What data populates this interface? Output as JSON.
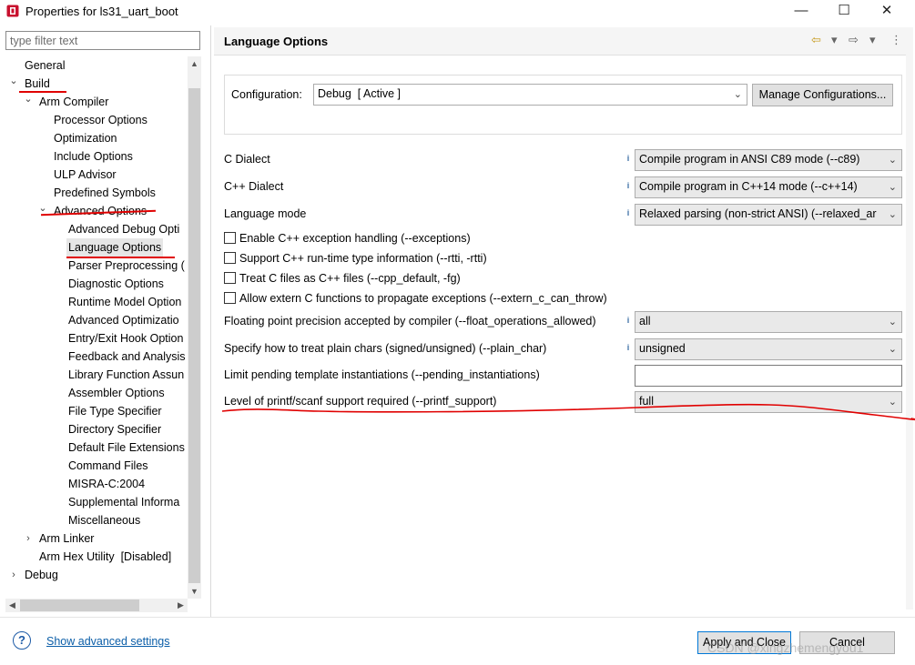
{
  "window": {
    "title": "Properties for ls31_uart_boot",
    "minimize": "—",
    "maximize": "☐",
    "close": "✕"
  },
  "filter": {
    "placeholder": "type filter text"
  },
  "tree": {
    "toggles": {
      "expanded": "⌄",
      "collapsed": "›"
    },
    "items": [
      {
        "label": "General"
      },
      {
        "label": "Build"
      },
      {
        "label": "Arm Compiler"
      },
      {
        "label": "Processor Options"
      },
      {
        "label": "Optimization"
      },
      {
        "label": "Include Options"
      },
      {
        "label": "ULP Advisor"
      },
      {
        "label": "Predefined Symbols"
      },
      {
        "label": "Advanced Options"
      },
      {
        "label": "Advanced Debug Opti"
      },
      {
        "label": "Language Options"
      },
      {
        "label": "Parser Preprocessing ("
      },
      {
        "label": "Diagnostic Options"
      },
      {
        "label": "Runtime Model Option"
      },
      {
        "label": "Advanced Optimizatio"
      },
      {
        "label": "Entry/Exit Hook Option"
      },
      {
        "label": "Feedback and Analysis"
      },
      {
        "label": "Library Function Assun"
      },
      {
        "label": "Assembler Options"
      },
      {
        "label": "File Type Specifier"
      },
      {
        "label": "Directory Specifier"
      },
      {
        "label": "Default File Extensions"
      },
      {
        "label": "Command Files"
      },
      {
        "label": "MISRA-C:2004"
      },
      {
        "label": "Supplemental Informa"
      },
      {
        "label": "Miscellaneous"
      },
      {
        "label": "Arm Linker"
      },
      {
        "label": "Arm Hex Utility  [Disabled]"
      },
      {
        "label": "Debug"
      }
    ]
  },
  "page": {
    "title": "Language Options",
    "nav_back": "⇦",
    "nav_forward": "⇨",
    "nav_menu": "▾",
    "more": "⋮",
    "configuration": {
      "label": "Configuration:",
      "value": "Debug  [ Active ]",
      "manage_button": "Manage Configurations..."
    },
    "combo_chevron": "⌄",
    "options": {
      "c_dialect": {
        "label": "C Dialect",
        "value": "Compile program in ANSI C89 mode (--c89)"
      },
      "cpp_dialect": {
        "label": "C++ Dialect",
        "value": "Compile program in C++14 mode (--c++14)"
      },
      "language_mode": {
        "label": "Language mode",
        "value": "Relaxed parsing (non-strict ANSI) (--relaxed_ar"
      },
      "checkboxes": [
        {
          "label": "Enable C++ exception handling (--exceptions)",
          "checked": false
        },
        {
          "label": "Support C++ run-time type information (--rtti, -rtti)",
          "checked": false
        },
        {
          "label": "Treat C files as C++ files (--cpp_default, -fg)",
          "checked": false
        },
        {
          "label": "Allow extern C functions to propagate exceptions (--extern_c_can_throw)",
          "checked": false
        }
      ],
      "float_ops": {
        "label": "Floating point precision accepted by compiler (--float_operations_allowed)",
        "value": "all"
      },
      "plain_char": {
        "label": "Specify how to treat plain chars (signed/unsigned) (--plain_char)",
        "value": "unsigned"
      },
      "pending_inst": {
        "label": "Limit pending template instantiations (--pending_instantiations)",
        "value": ""
      },
      "printf_support": {
        "label": "Level of printf/scanf support required (--printf_support)",
        "value": "full"
      }
    },
    "info_glyph": "i"
  },
  "footer": {
    "help_glyph": "?",
    "advanced_link": "Show advanced settings",
    "apply_button": "Apply and Close",
    "cancel_button": "Cancel",
    "watermark": "CSDN @xingzhemengyou1"
  },
  "colors": {
    "annotation_red": "#e00000",
    "link_blue": "#0b5ea8",
    "focus_blue": "#0078d7"
  }
}
